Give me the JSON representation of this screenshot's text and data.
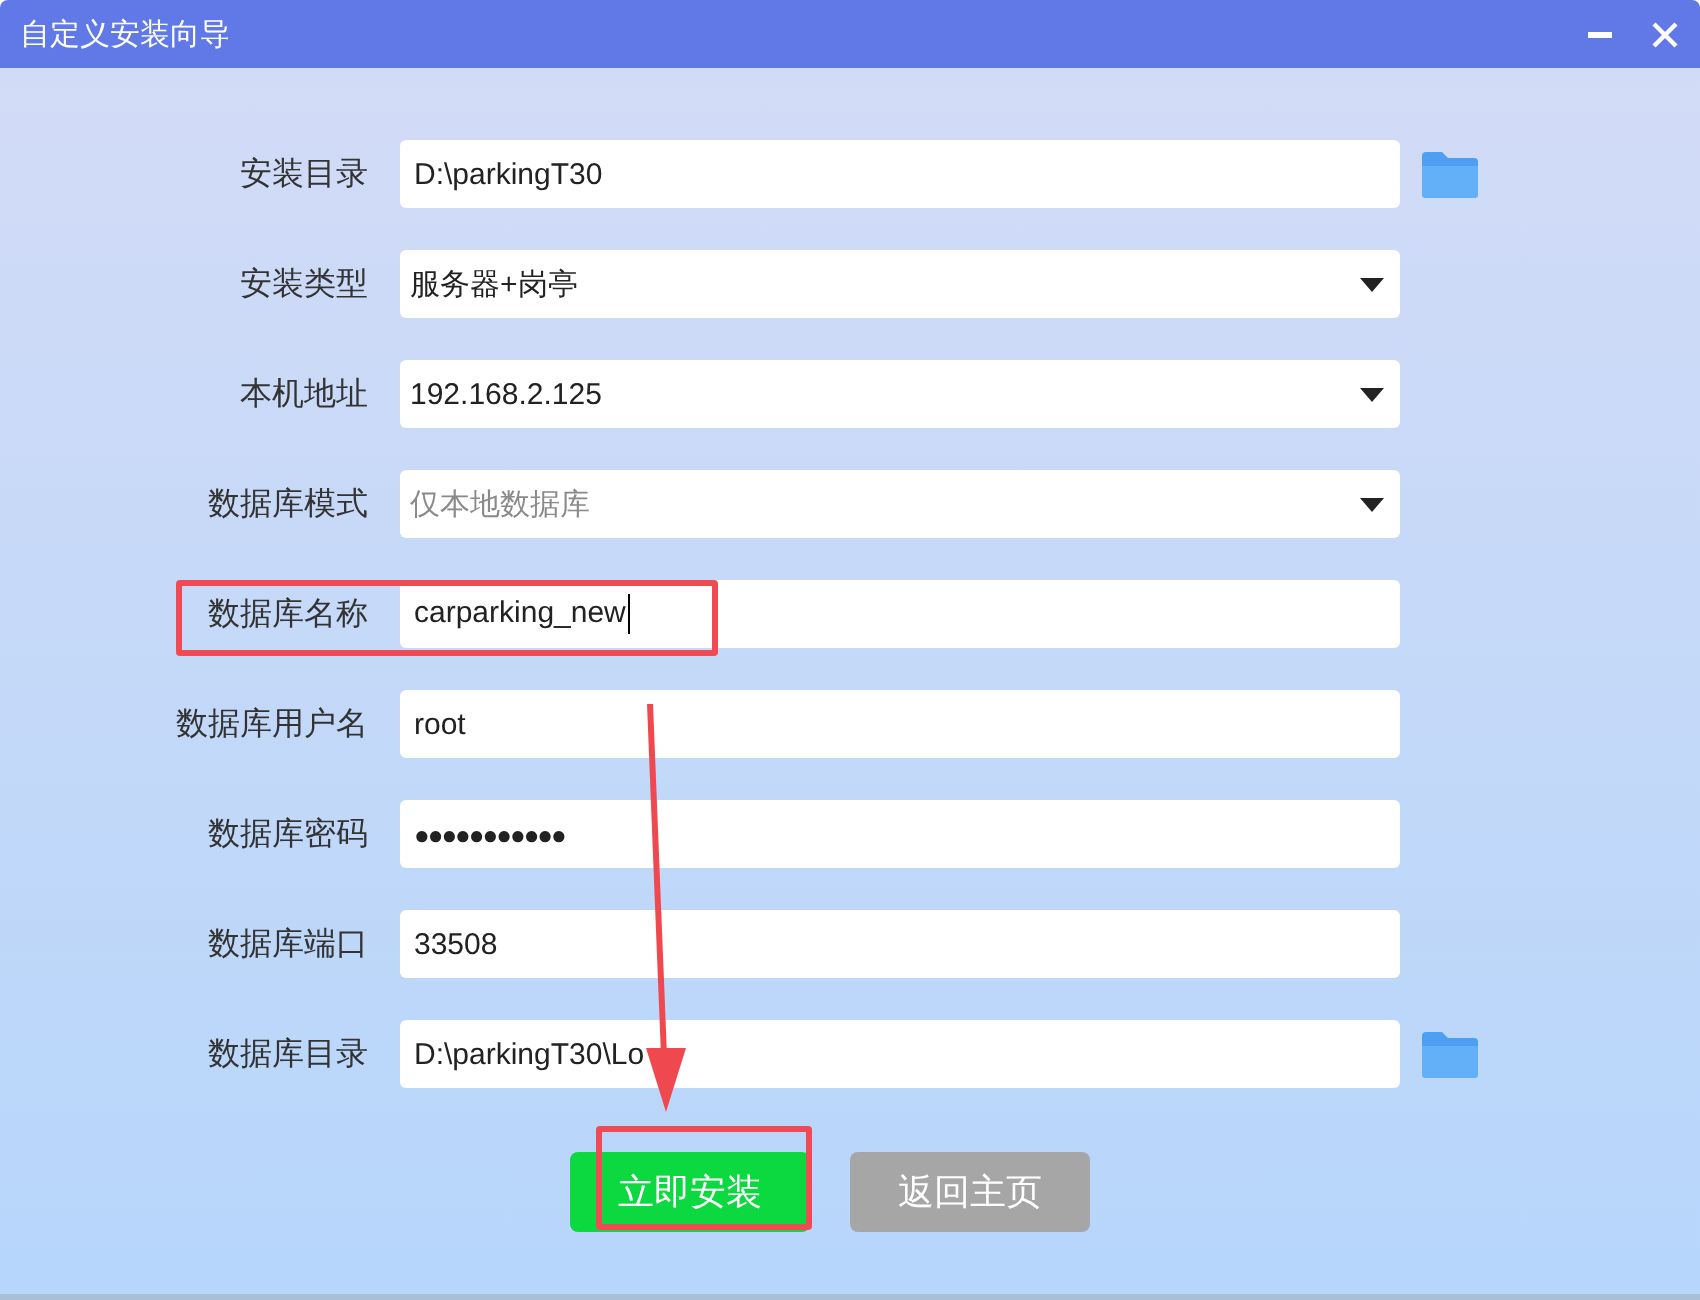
{
  "window": {
    "title": "自定义安装向导"
  },
  "fields": [
    {
      "label": "安装目录",
      "kind": "path",
      "value": "D:\\parkingT30",
      "highlighted": false,
      "focused": false
    },
    {
      "label": "安装类型",
      "kind": "select",
      "value": "服务器+岗亭",
      "highlighted": false,
      "focused": false
    },
    {
      "label": "本机地址",
      "kind": "select",
      "value": "192.168.2.125",
      "highlighted": false,
      "focused": false
    },
    {
      "label": "数据库模式",
      "kind": "select",
      "placeholder": "仅本地数据库",
      "highlighted": false,
      "focused": false
    },
    {
      "label": "数据库名称",
      "kind": "text",
      "value": "carparking_new",
      "highlighted": true,
      "focused": true
    },
    {
      "label": "数据库用户名",
      "kind": "text",
      "value": "root",
      "highlighted": false,
      "focused": false
    },
    {
      "label": "数据库密码",
      "kind": "password",
      "value": "●●●●●●●●●●●",
      "highlighted": false,
      "focused": false
    },
    {
      "label": "数据库端口",
      "kind": "text",
      "value": "33508",
      "highlighted": false,
      "focused": false
    },
    {
      "label": "数据库目录",
      "kind": "path",
      "value": "D:\\parkingT30\\Lo",
      "highlighted": false,
      "focused": false
    }
  ],
  "buttons": [
    {
      "label": "立即安装",
      "kind": "primary",
      "highlighted": true
    },
    {
      "label": "返回主页",
      "kind": "secondary",
      "highlighted": false
    }
  ],
  "annotations": {
    "arrow": true
  }
}
